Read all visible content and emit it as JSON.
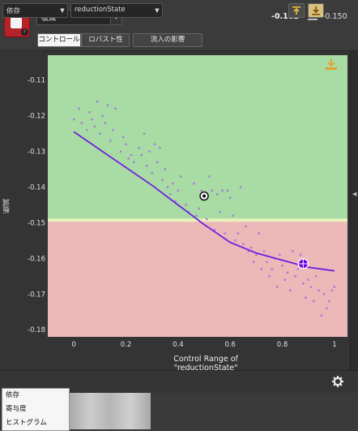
{
  "header": {
    "metric_select": "板減",
    "current_value": "-0.162",
    "baseline_value": "-0.150",
    "tabs": [
      "コントロール",
      "ロバスト性",
      "流入の影響"
    ],
    "active_tab": 0
  },
  "chart_data": {
    "type": "scatter",
    "ylabel": "板減",
    "xlabel_line1": "Control Range of",
    "xlabel_line2": "\"reductionState\"",
    "xlim": [
      -0.1,
      1.05
    ],
    "ylim": [
      -0.182,
      -0.103
    ],
    "x_ticks": [
      "0",
      "0.2",
      "0.4",
      "0.6",
      "0.8",
      "1"
    ],
    "x_tick_values": [
      0,
      0.2,
      0.4,
      0.6,
      0.8,
      1.0
    ],
    "y_ticks": [
      "-0.11",
      "-0.12",
      "-0.13",
      "-0.14",
      "-0.15",
      "-0.16",
      "-0.17",
      "-0.18"
    ],
    "y_tick_values": [
      -0.11,
      -0.12,
      -0.13,
      -0.14,
      -0.15,
      -0.16,
      -0.17,
      -0.18
    ],
    "threshold": -0.1495,
    "colors": {
      "good_region": "#a8dca4",
      "bad_region": "#edb8b8",
      "threshold_band": "#e8f2b8",
      "curve": "#7020e0",
      "points": "#a77cd6"
    },
    "curve": [
      [
        0,
        -0.1245
      ],
      [
        0.1,
        -0.1295
      ],
      [
        0.2,
        -0.1345
      ],
      [
        0.3,
        -0.1395
      ],
      [
        0.4,
        -0.145
      ],
      [
        0.5,
        -0.1505
      ],
      [
        0.6,
        -0.1555
      ],
      [
        0.7,
        -0.1585
      ],
      [
        0.8,
        -0.1605
      ],
      [
        0.9,
        -0.1625
      ],
      [
        1.0,
        -0.1635
      ]
    ],
    "current_point": {
      "x": 0.5,
      "y": -0.1425
    },
    "selected_point": {
      "x": 0.88,
      "y": -0.1615
    },
    "points": [
      [
        0.0,
        -0.121
      ],
      [
        0.02,
        -0.118
      ],
      [
        0.03,
        -0.122
      ],
      [
        0.05,
        -0.124
      ],
      [
        0.06,
        -0.119
      ],
      [
        0.07,
        -0.121
      ],
      [
        0.08,
        -0.123
      ],
      [
        0.09,
        -0.116
      ],
      [
        0.1,
        -0.125
      ],
      [
        0.11,
        -0.12
      ],
      [
        0.12,
        -0.122
      ],
      [
        0.13,
        -0.117
      ],
      [
        0.14,
        -0.127
      ],
      [
        0.15,
        -0.124
      ],
      [
        0.16,
        -0.118
      ],
      [
        0.18,
        -0.13
      ],
      [
        0.19,
        -0.126
      ],
      [
        0.2,
        -0.128
      ],
      [
        0.21,
        -0.132
      ],
      [
        0.22,
        -0.131
      ],
      [
        0.23,
        -0.133
      ],
      [
        0.25,
        -0.129
      ],
      [
        0.26,
        -0.131
      ],
      [
        0.27,
        -0.125
      ],
      [
        0.28,
        -0.134
      ],
      [
        0.29,
        -0.13
      ],
      [
        0.3,
        -0.136
      ],
      [
        0.31,
        -0.128
      ],
      [
        0.32,
        -0.133
      ],
      [
        0.33,
        -0.129
      ],
      [
        0.34,
        -0.138
      ],
      [
        0.35,
        -0.135
      ],
      [
        0.36,
        -0.14
      ],
      [
        0.37,
        -0.142
      ],
      [
        0.38,
        -0.139
      ],
      [
        0.39,
        -0.144
      ],
      [
        0.4,
        -0.141
      ],
      [
        0.41,
        -0.137
      ],
      [
        0.43,
        -0.145
      ],
      [
        0.44,
        -0.147
      ],
      [
        0.46,
        -0.139
      ],
      [
        0.47,
        -0.148
      ],
      [
        0.48,
        -0.146
      ],
      [
        0.49,
        -0.141
      ],
      [
        0.51,
        -0.149
      ],
      [
        0.52,
        -0.137
      ],
      [
        0.53,
        -0.141
      ],
      [
        0.54,
        -0.152
      ],
      [
        0.55,
        -0.142
      ],
      [
        0.56,
        -0.147
      ],
      [
        0.57,
        -0.141
      ],
      [
        0.58,
        -0.153
      ],
      [
        0.59,
        -0.141
      ],
      [
        0.6,
        -0.143
      ],
      [
        0.61,
        -0.148
      ],
      [
        0.62,
        -0.155
      ],
      [
        0.63,
        -0.153
      ],
      [
        0.64,
        -0.14
      ],
      [
        0.65,
        -0.156
      ],
      [
        0.66,
        -0.151
      ],
      [
        0.67,
        -0.158
      ],
      [
        0.68,
        -0.157
      ],
      [
        0.69,
        -0.161
      ],
      [
        0.7,
        -0.159
      ],
      [
        0.71,
        -0.153
      ],
      [
        0.72,
        -0.163
      ],
      [
        0.73,
        -0.158
      ],
      [
        0.74,
        -0.161
      ],
      [
        0.75,
        -0.165
      ],
      [
        0.76,
        -0.163
      ],
      [
        0.77,
        -0.16
      ],
      [
        0.78,
        -0.168
      ],
      [
        0.79,
        -0.159
      ],
      [
        0.8,
        -0.162
      ],
      [
        0.81,
        -0.166
      ],
      [
        0.82,
        -0.164
      ],
      [
        0.83,
        -0.169
      ],
      [
        0.84,
        -0.158
      ],
      [
        0.85,
        -0.165
      ],
      [
        0.86,
        -0.163
      ],
      [
        0.87,
        -0.159
      ],
      [
        0.88,
        -0.167
      ],
      [
        0.89,
        -0.171
      ],
      [
        0.9,
        -0.166
      ],
      [
        0.91,
        -0.168
      ],
      [
        0.92,
        -0.172
      ],
      [
        0.93,
        -0.165
      ],
      [
        0.94,
        -0.169
      ],
      [
        0.95,
        -0.176
      ],
      [
        0.96,
        -0.17
      ],
      [
        0.97,
        -0.174
      ],
      [
        0.98,
        -0.172
      ],
      [
        0.99,
        -0.169
      ],
      [
        1.0,
        -0.168
      ]
    ]
  },
  "footer": {
    "left_select": "依存",
    "param_select": "reductionState",
    "menu_items": [
      "依存",
      "寄与度",
      "ヒストグラム"
    ]
  }
}
